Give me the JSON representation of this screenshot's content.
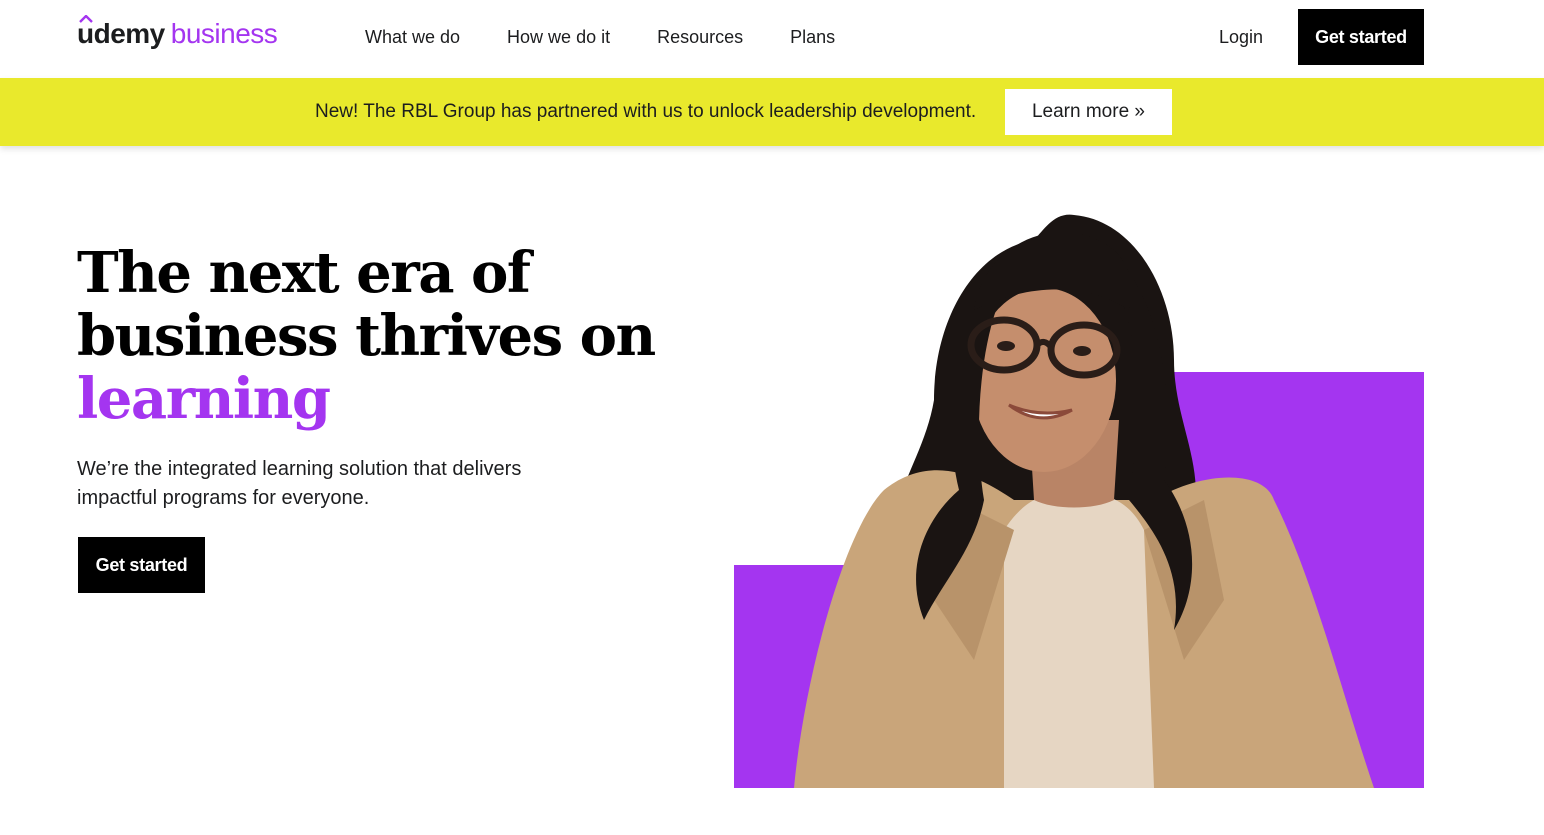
{
  "header": {
    "logo": {
      "brand": "udemy",
      "product": "business"
    },
    "nav": [
      "What we do",
      "How we do it",
      "Resources",
      "Plans"
    ],
    "login_label": "Login",
    "cta_label": "Get started"
  },
  "banner": {
    "text": "New! The RBL Group has partnered with us to unlock leadership development.",
    "button_label": "Learn more »"
  },
  "hero": {
    "title_lines": [
      "The next era of",
      "business thrives on"
    ],
    "title_accent": "learning",
    "subtitle": "We’re the integrated learning solution that delivers impactful programs for everyone.",
    "cta_label": "Get started"
  },
  "colors": {
    "brand_purple": "#a435f0",
    "banner_yellow": "#e9e92c",
    "black": "#000000"
  }
}
